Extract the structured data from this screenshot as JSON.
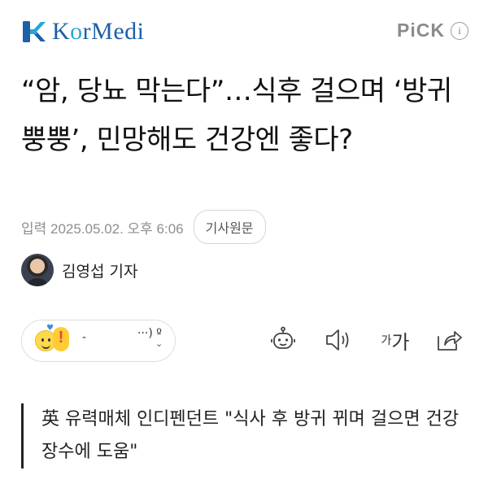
{
  "header": {
    "logo_text_k": "K",
    "logo_text_o": "o",
    "logo_text_rest": "rMedi",
    "pick_label": "PiCK",
    "info_glyph": "i"
  },
  "article": {
    "headline": "“암, 당뇨 막는다”…식후 걸으며 ‘방귀 뿡뿡’, 민망해도 건강엔 좋다?",
    "input_label": "입력",
    "input_date": "2025.05.02. 오후 6:06",
    "original_button": "기사원문",
    "author": "김영섭 기자",
    "quote": "英 유력매체 인디펜던트 \"식사 후 방귀 뀌며 걸으면 건강장수에 도움\""
  },
  "reactions": {
    "count_glyph": "-",
    "more_glyph": "···) º",
    "chevron_glyph": "⌄"
  },
  "tools": {
    "font_small": "가",
    "font_big": "가"
  },
  "icons": {
    "logo": "kormedi-cross-icon",
    "info": "info-icon",
    "ai_summary": "robot-icon",
    "audio": "speaker-icon",
    "font_size": "font-size-icon",
    "share": "share-icon",
    "emoji_smile": "smile-emoji-icon",
    "emoji_surprise": "surprise-emoji-icon"
  },
  "colors": {
    "brand_blue": "#1d5fa8",
    "brand_cyan": "#27a7d9",
    "meta_gray": "#8e8e8e"
  }
}
